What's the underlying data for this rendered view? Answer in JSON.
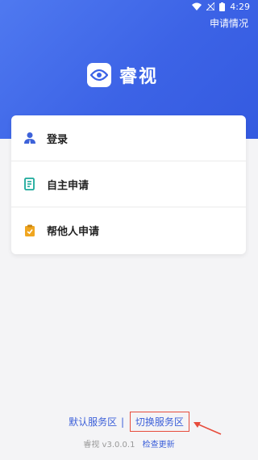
{
  "status_bar": {
    "time": "4:29"
  },
  "header": {
    "apply_status": "申请情况"
  },
  "logo": {
    "name": "睿视"
  },
  "menu": {
    "items": [
      {
        "label": "登录",
        "icon": "user-icon"
      },
      {
        "label": "自主申请",
        "icon": "form-icon"
      },
      {
        "label": "帮他人申请",
        "icon": "clipboard-icon"
      }
    ]
  },
  "footer": {
    "default_region": "默认服务区",
    "switch_region": "切换服务区",
    "app_name": "睿视",
    "version": "v3.0.0.1",
    "check_update": "检查更新"
  },
  "colors": {
    "primary": "#3c63e6",
    "user_icon": "#3d62d9",
    "form_icon": "#1aa99a",
    "clipboard_icon": "#f0a620",
    "highlight_box": "#e74c3c"
  }
}
